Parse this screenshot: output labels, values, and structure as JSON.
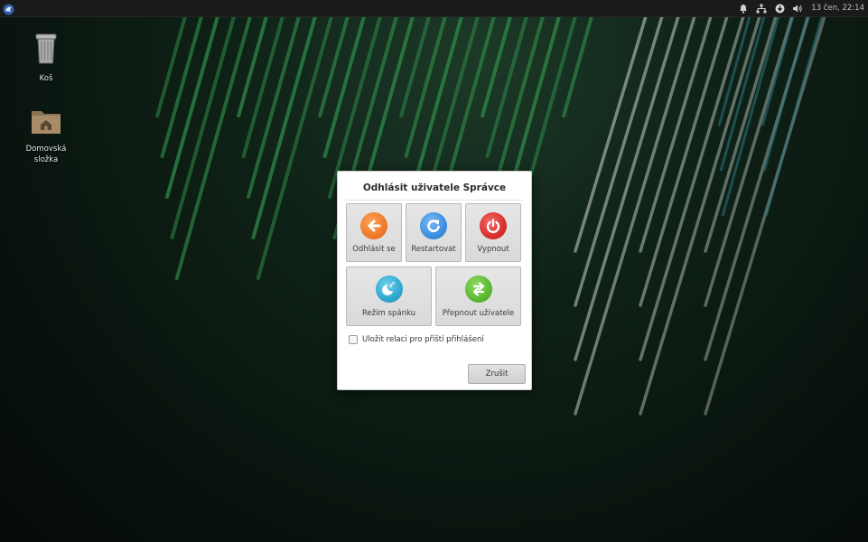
{
  "panel": {
    "clock": "13 čen, 22:14",
    "tray_icons": [
      "notification-bell-icon",
      "network-icon",
      "update-icon",
      "volume-icon"
    ]
  },
  "desktop": {
    "icons": [
      {
        "label": "Koš",
        "icon": "trash-icon"
      },
      {
        "label": "Domovská složka",
        "icon": "home-folder-icon"
      }
    ]
  },
  "dialog": {
    "title": "Odhlásit uživatele Správce",
    "actions": [
      {
        "label": "Odhlásit se",
        "icon": "logout-arrow-icon",
        "color": "#f07a2a"
      },
      {
        "label": "Restartovat",
        "icon": "restart-icon",
        "color": "#3d8fe0"
      },
      {
        "label": "Vypnout",
        "icon": "power-icon",
        "color": "#d9302f"
      },
      {
        "label": "Režim spánku",
        "icon": "sleep-moon-icon",
        "color": "#2fa8d0"
      },
      {
        "label": "Přepnout uživatele",
        "icon": "switch-user-icon",
        "color": "#5cb832"
      }
    ],
    "save_session_label": "Uložit relaci pro příští přihlášení",
    "save_session_checked": false,
    "cancel_label": "Zrušit"
  }
}
